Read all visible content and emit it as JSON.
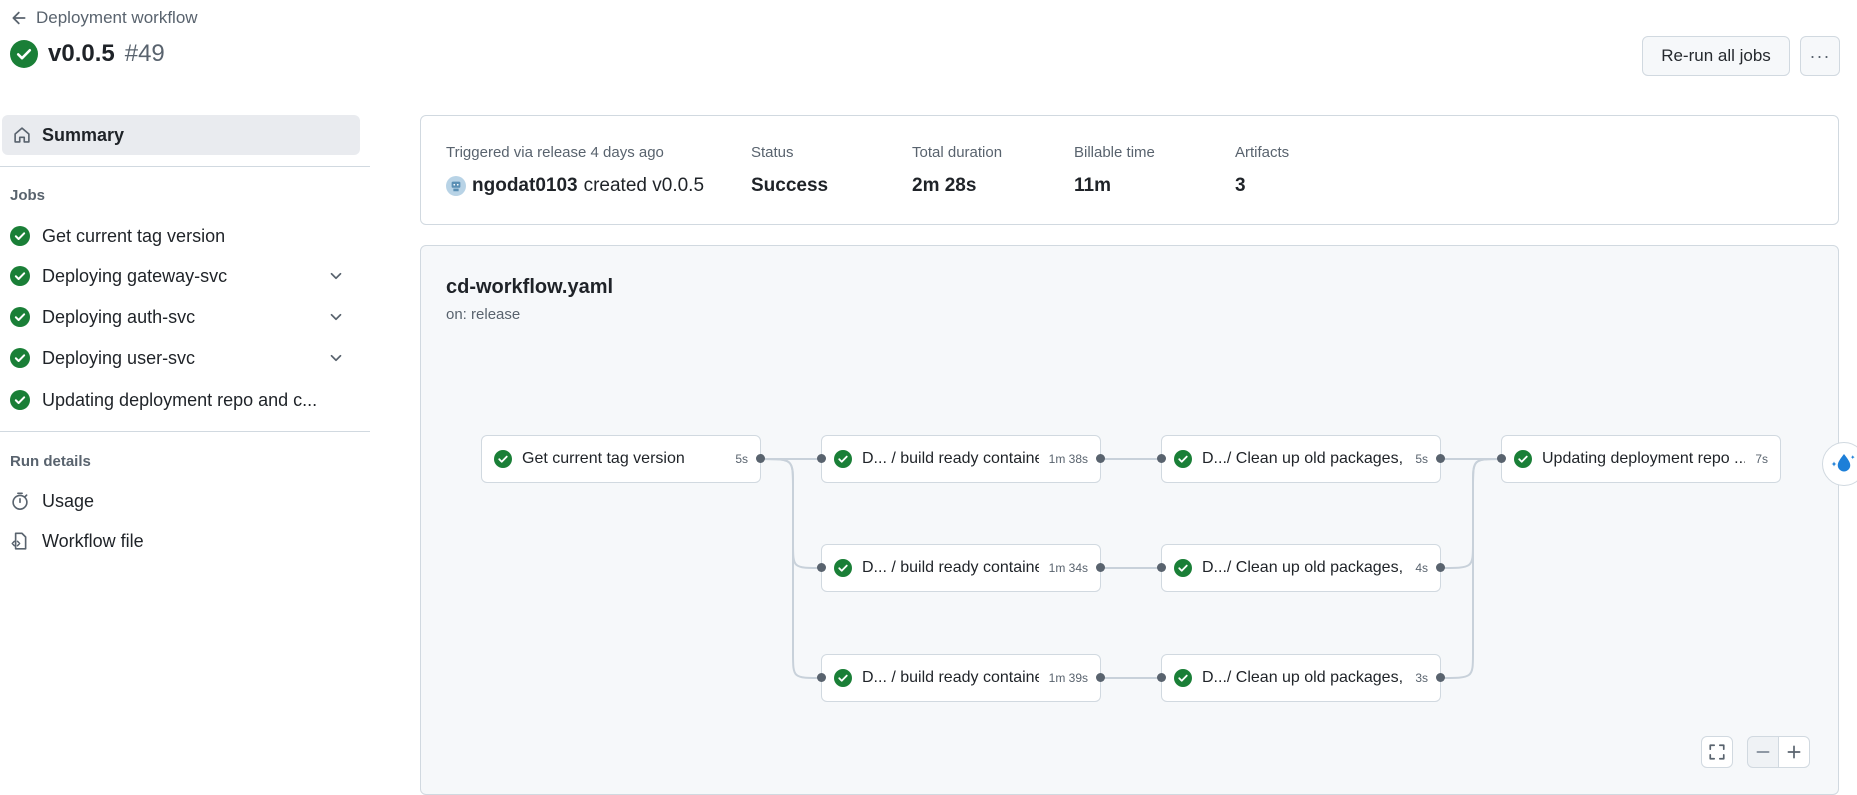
{
  "header": {
    "back_label": "Deployment workflow",
    "run_name": "v0.0.5",
    "run_number": "#49",
    "rerun_label": "Re-run all jobs",
    "more_label": "···"
  },
  "sidebar": {
    "summary_label": "Summary",
    "jobs_heading": "Jobs",
    "jobs": [
      {
        "label": "Get current tag version",
        "expandable": false
      },
      {
        "label": "Deploying gateway-svc",
        "expandable": true
      },
      {
        "label": "Deploying auth-svc",
        "expandable": true
      },
      {
        "label": "Deploying user-svc",
        "expandable": true
      },
      {
        "label": "Updating deployment repo and c...",
        "expandable": false
      }
    ],
    "run_details_heading": "Run details",
    "usage_label": "Usage",
    "workflow_file_label": "Workflow file"
  },
  "summary": {
    "triggered_label": "Triggered via release 4 days ago",
    "actor": "ngodat0103",
    "action": "created v0.0.5",
    "status_label": "Status",
    "status_value": "Success",
    "duration_label": "Total duration",
    "duration_value": "2m 28s",
    "billable_label": "Billable time",
    "billable_value": "11m",
    "artifacts_label": "Artifacts",
    "artifacts_value": "3"
  },
  "workflow": {
    "file_name": "cd-workflow.yaml",
    "trigger": "on: release",
    "nodes": [
      {
        "label": "Get current tag version",
        "duration": "5s"
      },
      {
        "label": "D... / build ready container",
        "duration": "1m 38s"
      },
      {
        "label": "D.../ Clean up old packages, ...",
        "duration": "5s"
      },
      {
        "label": "Updating deployment repo ...",
        "duration": "7s"
      },
      {
        "label": "D... / build ready container",
        "duration": "1m 34s"
      },
      {
        "label": "D.../ Clean up old packages, ...",
        "duration": "4s"
      },
      {
        "label": "D... / build ready container",
        "duration": "1m 39s"
      },
      {
        "label": "D.../ Clean up old packages, ...",
        "duration": "3s"
      }
    ]
  },
  "colors": {
    "success": "#1a7f37",
    "muted": "#59636e",
    "border": "#d1d9e0",
    "canvas": "#f6f8fa"
  }
}
